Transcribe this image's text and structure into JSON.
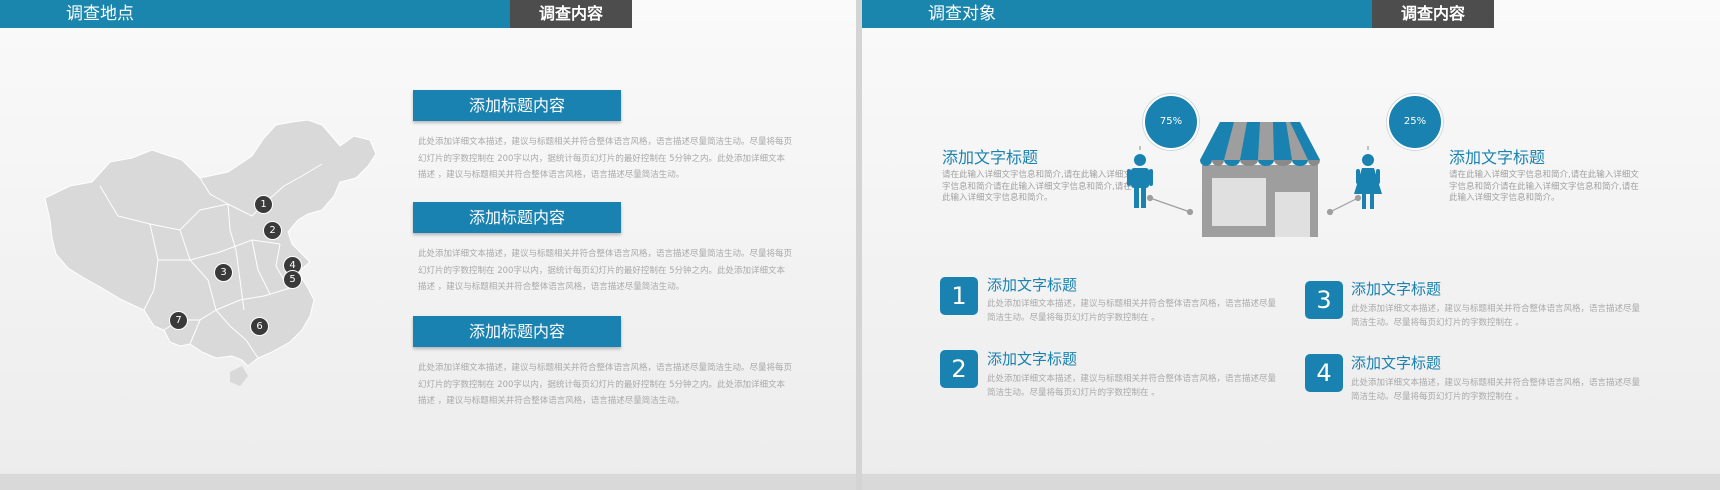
{
  "left_slide": {
    "header_title": "调查地点",
    "header_tag": "调查内容",
    "map_pins": [
      "1",
      "2",
      "3",
      "4",
      "5",
      "6",
      "7"
    ],
    "blocks": [
      {
        "title": "添加标题内容",
        "text": "此处添加详细文本描述，建议与标题相关并符合整体语言风格，语言描述尽量简洁生动。尽量将每页幻灯片的字数控制在 200字以内，据统计每页幻灯片的最好控制在 5分钟之内。此处添加详细文本描述 ，建议与标题相关并符合整体语言风格，语言描述尽量简洁生动。"
      },
      {
        "title": "添加标题内容",
        "text": "此处添加详细文本描述，建议与标题相关并符合整体语言风格，语言描述尽量简洁生动。尽量将每页幻灯片的字数控制在 200字以内，据统计每页幻灯片的最好控制在 5分钟之内。此处添加详细文本描述 ，建议与标题相关并符合整体语言风格，语言描述尽量简洁生动。"
      },
      {
        "title": "添加标题内容",
        "text": "此处添加详细文本描述，建议与标题相关并符合整体语言风格，语言描述尽量简洁生动。尽量将每页幻灯片的字数控制在 200字以内，据统计每页幻灯片的最好控制在 5分钟之内。此处添加详细文本描述 ，建议与标题相关并符合整体语言风格，语言描述尽量简洁生动。"
      }
    ]
  },
  "right_slide": {
    "header_title": "调查对象",
    "header_tag": "调查内容",
    "male_percent": "75%",
    "female_percent": "25%",
    "left_title": "添加文字标题",
    "left_text": "请在此输入详细文字信息和简介,请在此输入详细文字信息和简介请在此输入详细文字信息和简介,请在此输入详细文字信息和简介。",
    "right_title": "添加文字标题",
    "right_text": "请在此输入详细文字信息和简介,请在此输入详细文字信息和简介请在此输入详细文字信息和简介,请在此输入详细文字信息和简介。",
    "items": [
      {
        "num": "1",
        "title": "添加文字标题",
        "text": "此处添加详细文本描述，建议与标题相关并符合整体语言风格，语言描述尽量简洁生动。尽量将每页幻灯片的字数控制在 。"
      },
      {
        "num": "2",
        "title": "添加文字标题",
        "text": "此处添加详细文本描述，建议与标题相关并符合整体语言风格，语言描述尽量简洁生动。尽量将每页幻灯片的字数控制在 。"
      },
      {
        "num": "3",
        "title": "添加文字标题",
        "text": "此处添加详细文本描述，建议与标题相关并符合整体语言风格，语言描述尽量简洁生动。尽量将每页幻灯片的字数控制在 。"
      },
      {
        "num": "4",
        "title": "添加文字标题",
        "text": "此处添加详细文本描述，建议与标题相关并符合整体语言风格，语言描述尽量简洁生动。尽量将每页幻灯片的字数控制在 。"
      }
    ]
  },
  "colors": {
    "accent": "#1982b1",
    "header": "#1a86ad",
    "tag": "#4d4d4d",
    "map": "#d9d9d9",
    "shop_gray": "#9e9e9e"
  },
  "icons": [
    "china-map-icon",
    "shop-icon",
    "male-person-icon",
    "female-person-icon"
  ]
}
